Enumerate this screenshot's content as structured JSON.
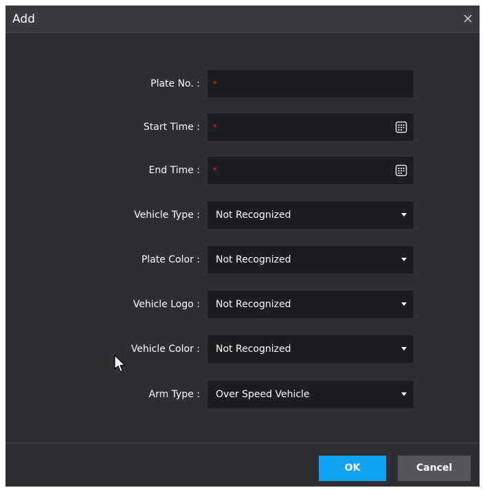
{
  "dialog": {
    "title": "Add",
    "close_icon": "close-icon"
  },
  "form": {
    "plate_no": {
      "label": "Plate No. :",
      "value": "",
      "required_mark": "*"
    },
    "start_time": {
      "label": "Start Time :",
      "value": "",
      "required_mark": "*",
      "icon": "calendar-icon"
    },
    "end_time": {
      "label": "End Time :",
      "value": "",
      "required_mark": "*",
      "icon": "calendar-icon"
    },
    "vehicle_type": {
      "label": "Vehicle Type :",
      "value": "Not Recognized"
    },
    "plate_color": {
      "label": "Plate Color :",
      "value": "Not Recognized"
    },
    "vehicle_logo": {
      "label": "Vehicle Logo :",
      "value": "Not Recognized"
    },
    "vehicle_color": {
      "label": "Vehicle Color :",
      "value": "Not Recognized"
    },
    "arm_type": {
      "label": "Arm Type :",
      "value": "Over Speed Vehicle"
    }
  },
  "footer": {
    "ok_label": "OK",
    "cancel_label": "Cancel"
  },
  "colors": {
    "background": "#2e2f33",
    "title_bar": "#3a3b3f",
    "input": "#1c1d20",
    "required": "#e0241b",
    "ok_button": "#11a1f5",
    "cancel_button": "#55565a"
  }
}
